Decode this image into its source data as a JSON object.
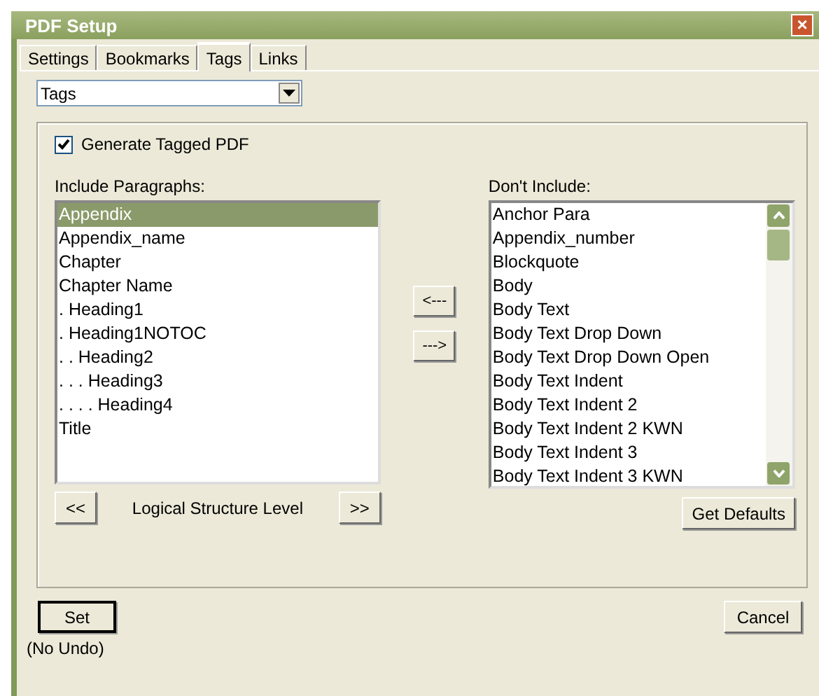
{
  "window": {
    "title": "PDF Setup",
    "close": "×"
  },
  "tabs": [
    {
      "label": "Settings",
      "selected": false
    },
    {
      "label": "Bookmarks",
      "selected": false
    },
    {
      "label": "Tags",
      "selected": true
    },
    {
      "label": "Links",
      "selected": false
    }
  ],
  "dropdown": {
    "value": "Tags"
  },
  "generate_tagged": {
    "label": "Generate Tagged PDF",
    "checked": true
  },
  "include": {
    "label": "Include Paragraphs:",
    "items": [
      {
        "text": "Appendix",
        "selected": true
      },
      {
        "text": "Appendix_name",
        "selected": false
      },
      {
        "text": "Chapter",
        "selected": false
      },
      {
        "text": "Chapter Name",
        "selected": false
      },
      {
        "text": ". Heading1",
        "selected": false
      },
      {
        "text": ". Heading1NOTOC",
        "selected": false
      },
      {
        "text": ". . Heading2",
        "selected": false
      },
      {
        "text": ". . . Heading3",
        "selected": false
      },
      {
        "text": ". . . . Heading4",
        "selected": false
      },
      {
        "text": "Title",
        "selected": false
      }
    ]
  },
  "move_buttons": [
    "<---",
    "--->"
  ],
  "exclude": {
    "label": "Don't Include:",
    "items": [
      {
        "text": "Anchor Para",
        "selected": false
      },
      {
        "text": "Appendix_number",
        "selected": false
      },
      {
        "text": "Blockquote",
        "selected": false
      },
      {
        "text": "Body",
        "selected": false
      },
      {
        "text": "Body Text",
        "selected": false
      },
      {
        "text": "Body Text Drop Down",
        "selected": false
      },
      {
        "text": "Body Text Drop Down Open",
        "selected": false
      },
      {
        "text": "Body Text Indent",
        "selected": false
      },
      {
        "text": "Body Text Indent 2",
        "selected": false
      },
      {
        "text": "Body Text Indent 2 KWN",
        "selected": false
      },
      {
        "text": "Body Text Indent 3",
        "selected": false
      },
      {
        "text": "Body Text Indent 3 KWN",
        "selected": false
      }
    ]
  },
  "level": {
    "prev": "<<",
    "label": "Logical Structure Level",
    "next": ">>"
  },
  "get_defaults": "Get Defaults",
  "set": "Set",
  "cancel": "Cancel",
  "note": "(No Undo)"
}
